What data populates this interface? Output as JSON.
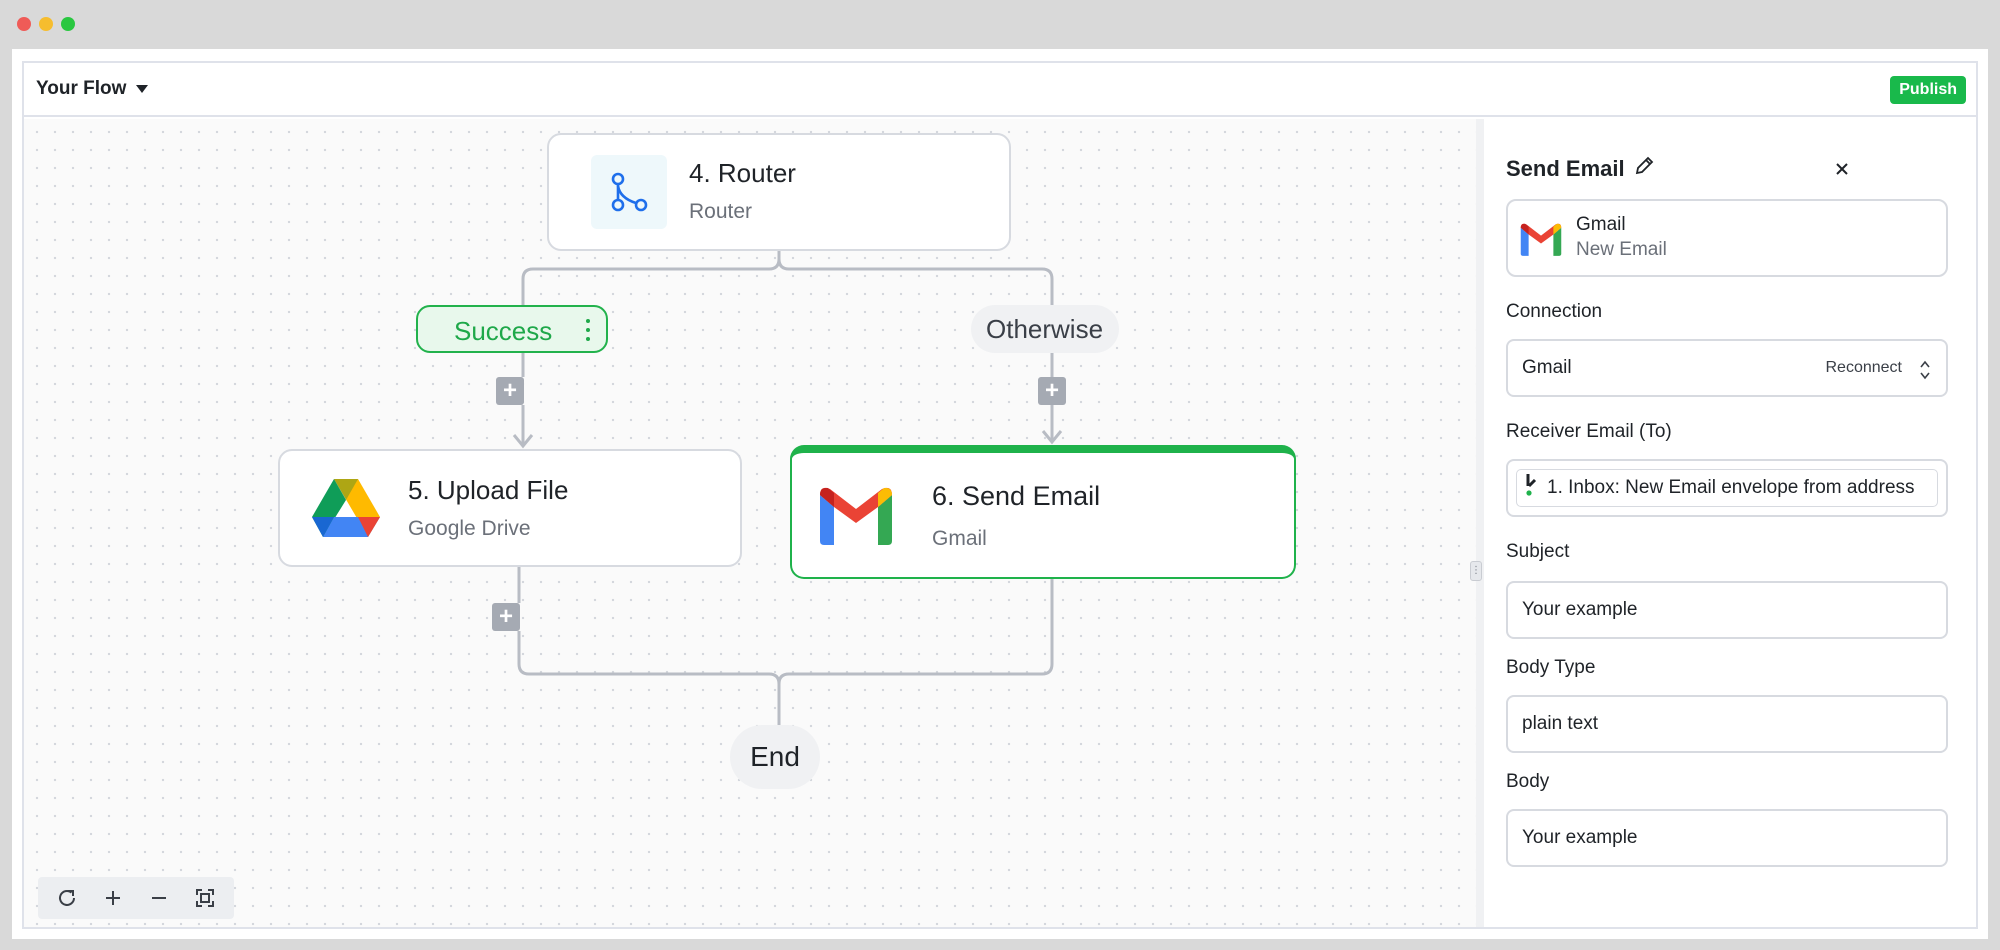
{
  "window": {
    "controls": [
      "close",
      "minimize",
      "maximize"
    ]
  },
  "header": {
    "flow_title": "Your Flow",
    "publish_label": "Publish",
    "publish_color": "#19b94b"
  },
  "canvas": {
    "nodes": [
      {
        "title": "4. Router",
        "subtitle": "Router",
        "icon": "router-icon"
      },
      {
        "title": "5. Upload File",
        "subtitle": "Google Drive",
        "icon": "google-drive-icon"
      },
      {
        "title": "6. Send Email",
        "subtitle": "Gmail",
        "icon": "gmail-icon",
        "selected": true
      }
    ],
    "branches": {
      "success_label": "Success",
      "otherwise_label": "Otherwise"
    },
    "end_label": "End",
    "zoom_controls": [
      "reset-icon",
      "zoom-in-icon",
      "zoom-out-icon",
      "fit-screen-icon"
    ]
  },
  "panel": {
    "title": "Send Email",
    "piece": {
      "name": "Gmail",
      "trigger": "New Email"
    },
    "connection": {
      "label": "Connection",
      "value": "Gmail",
      "action": "Reconnect"
    },
    "receiver": {
      "label": "Receiver Email (To)",
      "token": "1. Inbox: New Email envelope from address"
    },
    "subject": {
      "label": "Subject",
      "placeholder": "Your example"
    },
    "body_type": {
      "label": "Body Type",
      "value": "plain text"
    },
    "body": {
      "label": "Body",
      "placeholder": "Your example"
    }
  },
  "colors": {
    "accent_green": "#1fb24b",
    "success_text": "#1fa84a",
    "border": "#d7dae0"
  }
}
